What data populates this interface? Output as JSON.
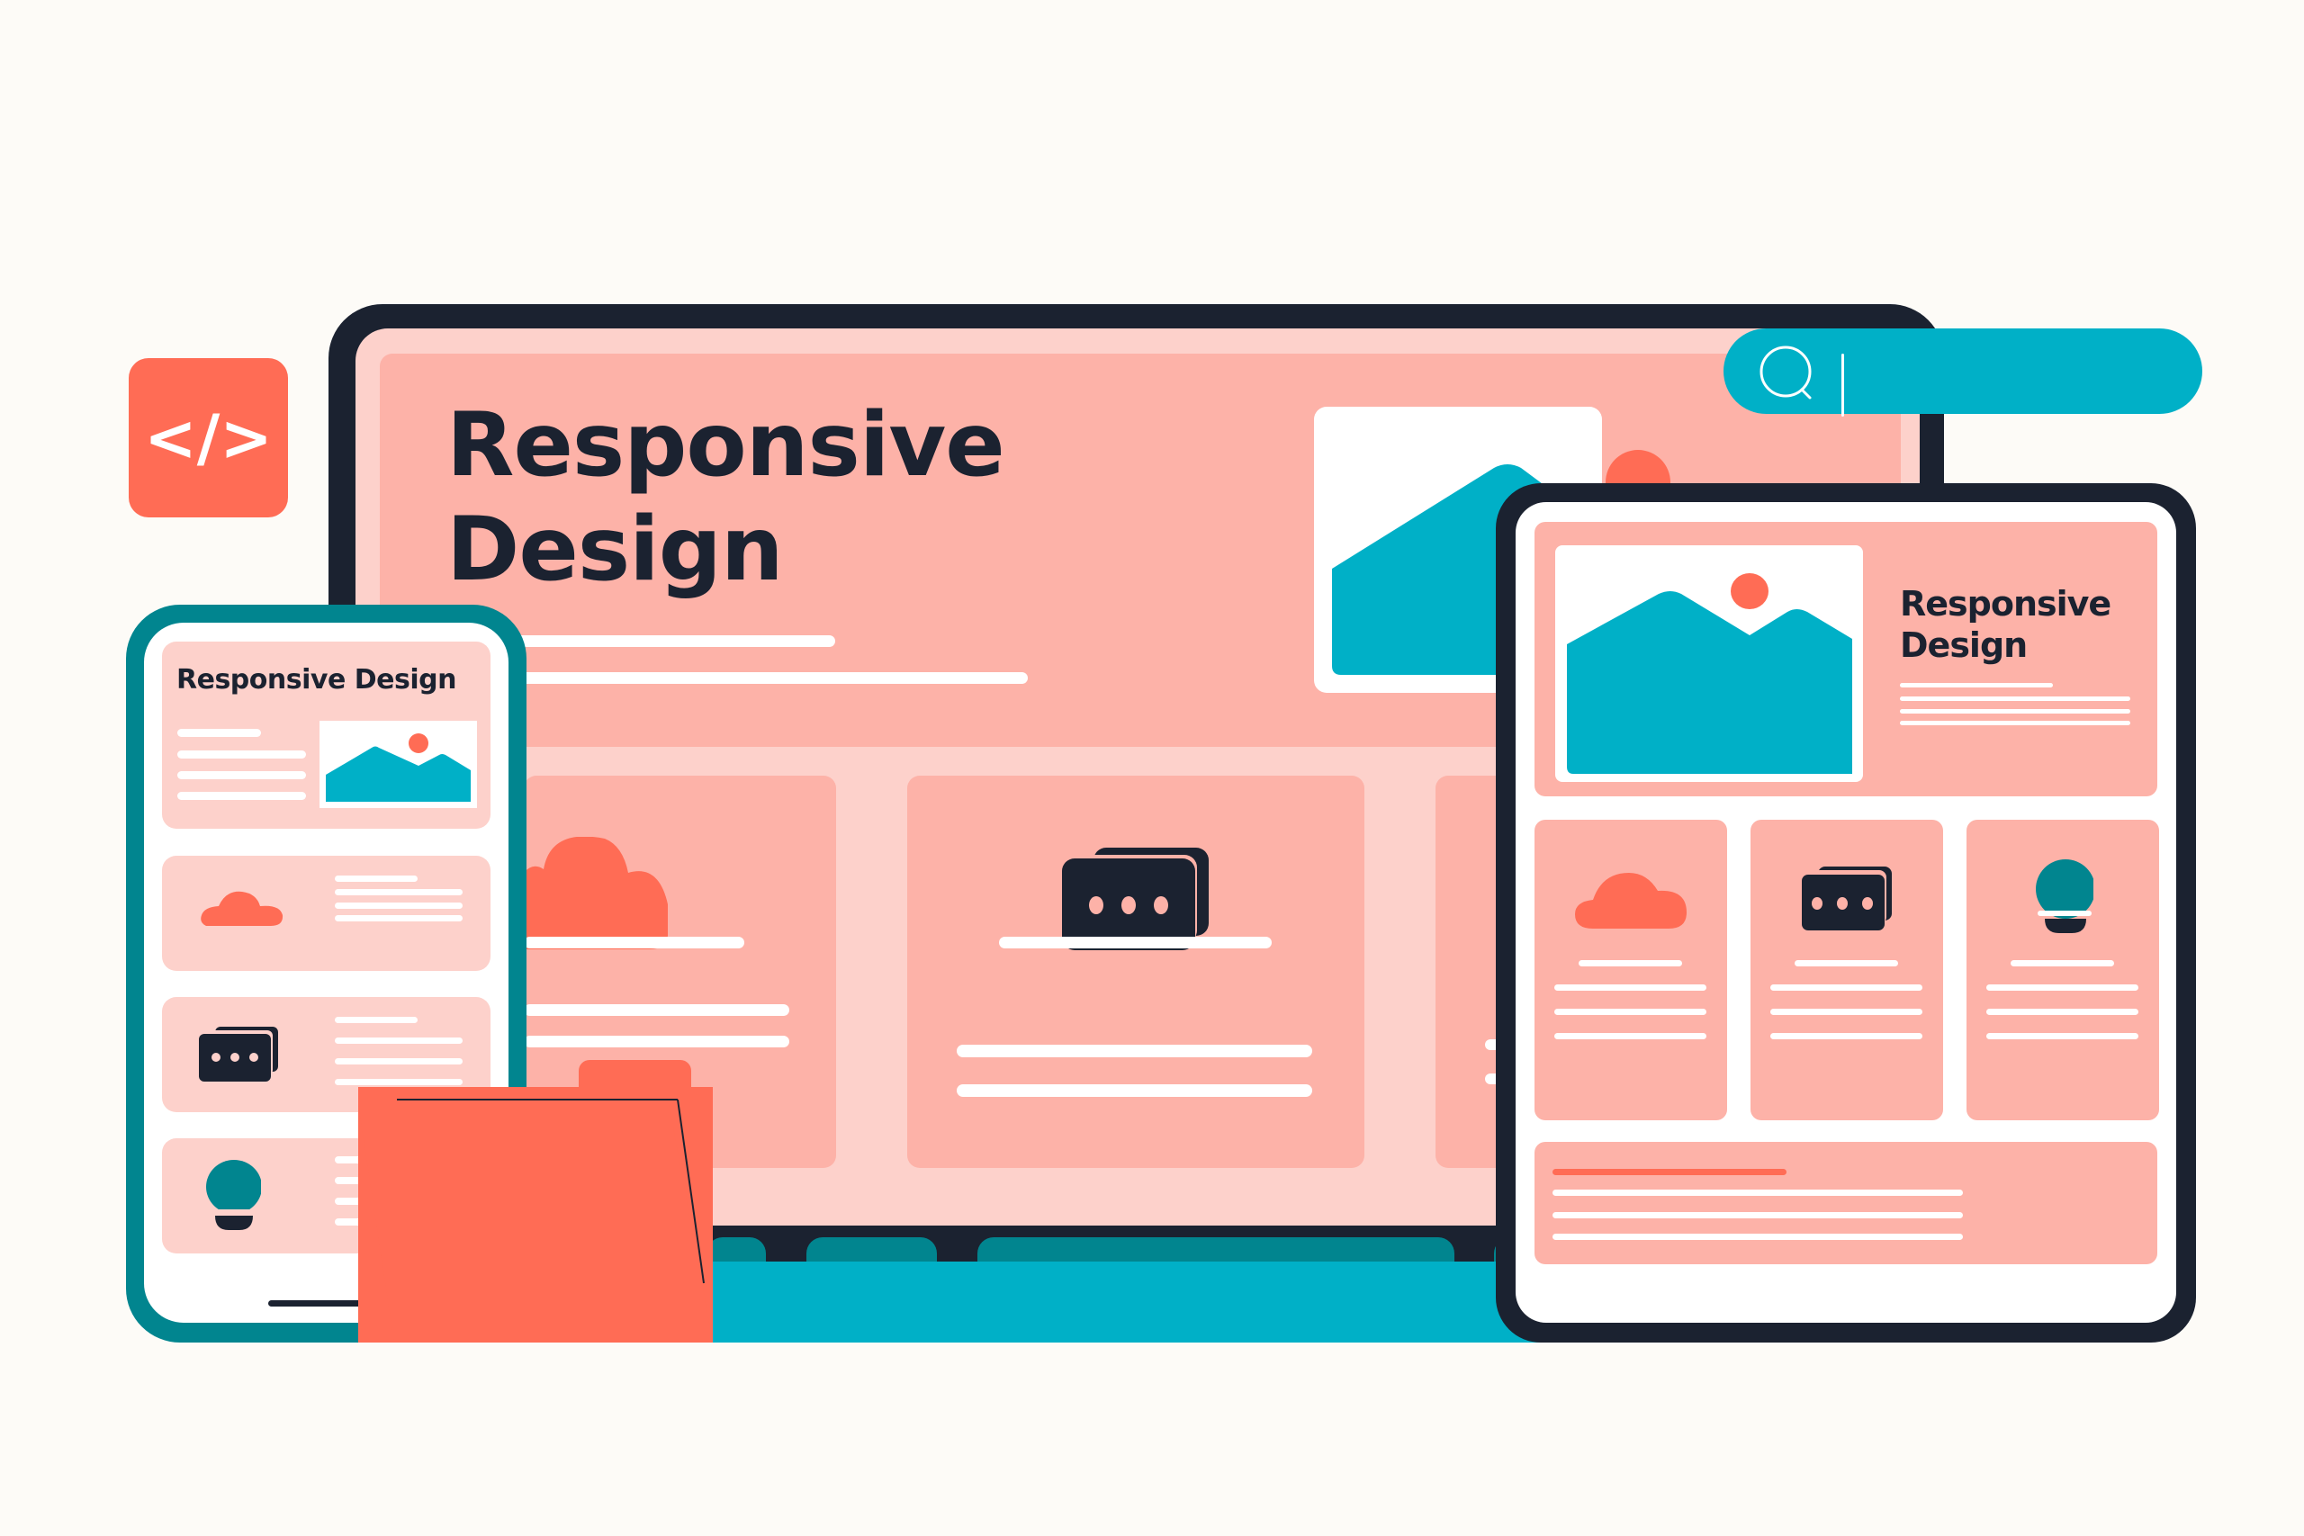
{
  "colors": {
    "background": "#FDFBF7",
    "dark": "#1B2230",
    "coral": "#FF6C55",
    "salmon": "#FDB2A8",
    "light_pink": "#FDD1CB",
    "teal": "#00B0C7",
    "dark_teal": "#01858F",
    "white": "#FFFFFF"
  },
  "code_badge": {
    "icon": "code-brackets-icon",
    "glyph": "</>"
  },
  "search_bar": {
    "icon": "search-icon",
    "value": ""
  },
  "monitor": {
    "title_line1": "Responsive",
    "title_line2": "Design",
    "hero_image_icon": "landscape-image-icon",
    "cards": [
      {
        "icon": "cloud-icon"
      },
      {
        "icon": "chat-bubbles-icon"
      },
      {
        "icon": "partially-hidden-card"
      }
    ]
  },
  "phone": {
    "title": "Responsive Design",
    "hero_image_icon": "landscape-image-icon",
    "rows": [
      {
        "icon": "cloud-icon"
      },
      {
        "icon": "chat-bubbles-icon"
      },
      {
        "icon": "lightbulb-icon"
      }
    ]
  },
  "tablet": {
    "title_line1": "Responsive",
    "title_line2": "Design",
    "hero_image_icon": "landscape-image-icon",
    "cards": [
      {
        "icon": "cloud-icon"
      },
      {
        "icon": "chat-bubbles-icon"
      },
      {
        "icon": "lightbulb-icon"
      }
    ]
  },
  "folder": {
    "icon": "folder-icon"
  }
}
